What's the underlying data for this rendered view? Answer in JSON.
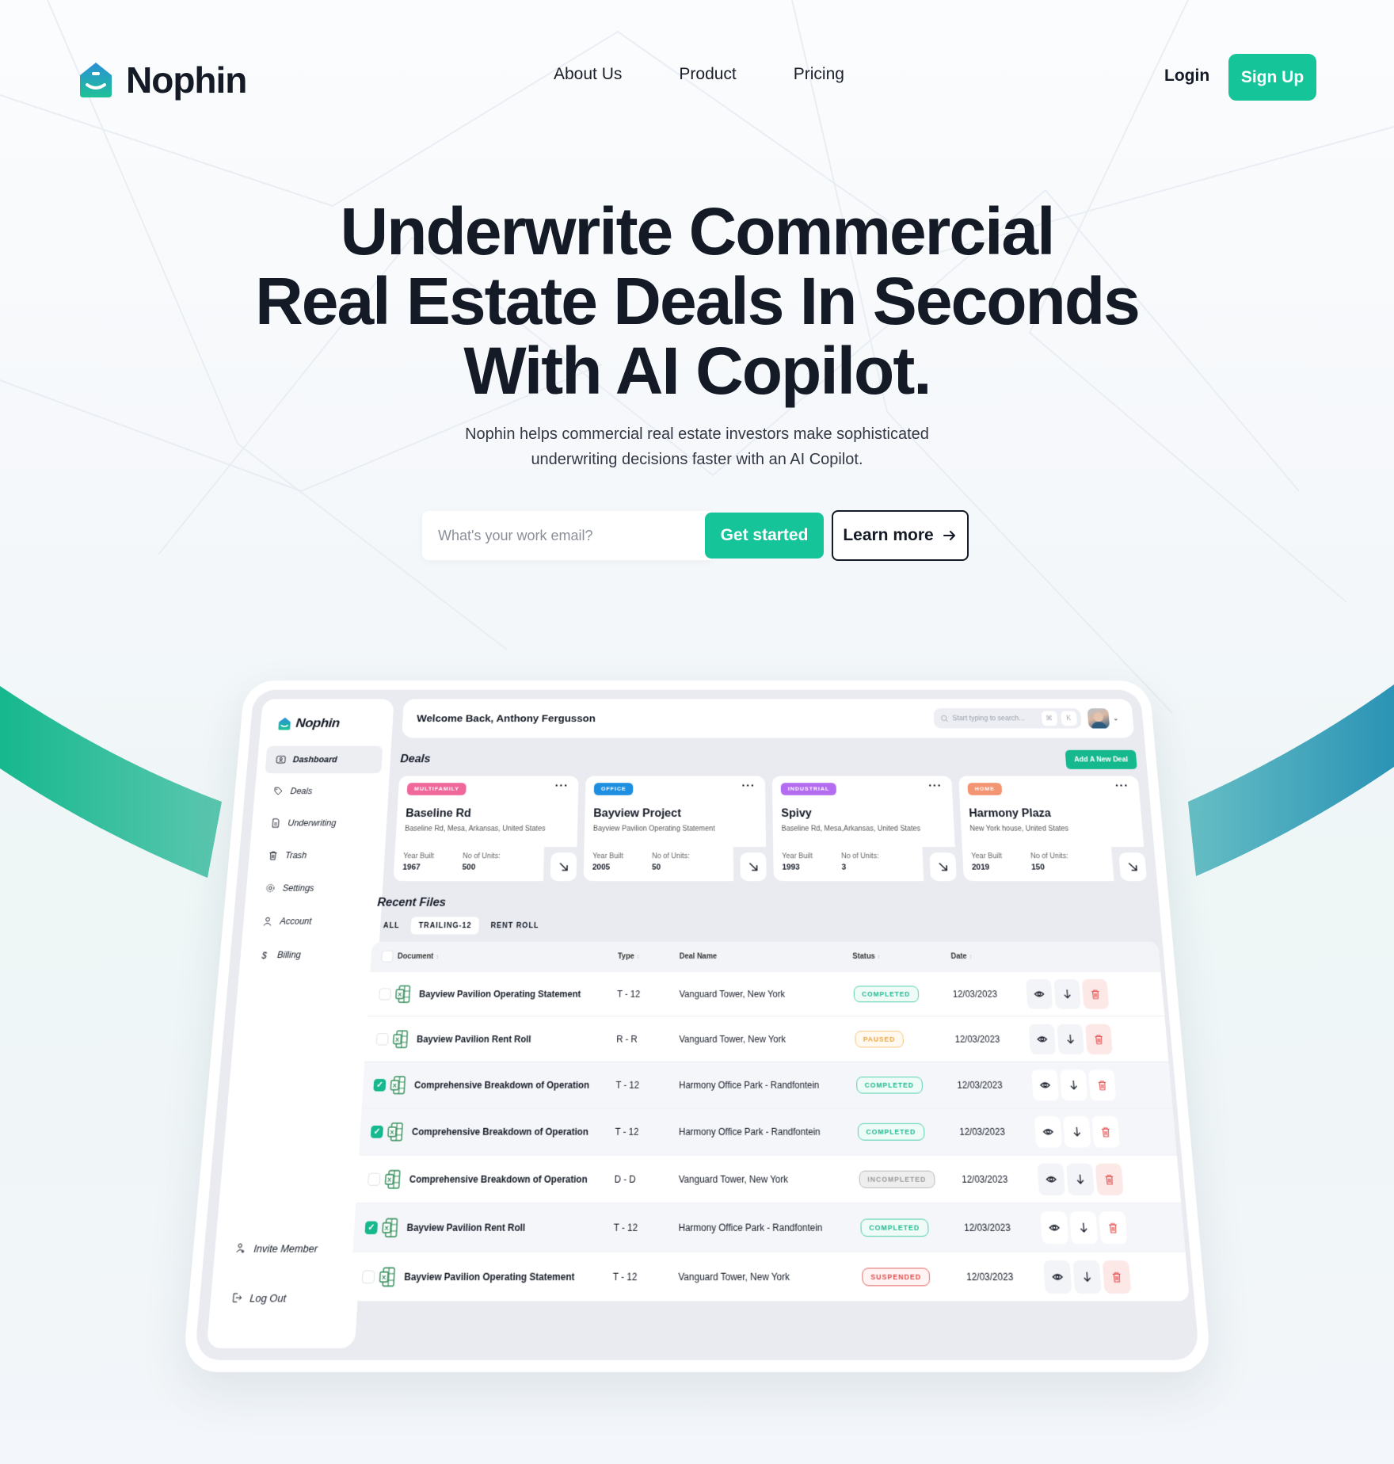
{
  "brand": {
    "name": "Nophin",
    "accent": "#16c49a",
    "accent_dark": "#16b88e",
    "text": "#141a26"
  },
  "nav": {
    "links": [
      "About Us",
      "Product",
      "Pricing"
    ],
    "login": "Login",
    "signup": "Sign Up"
  },
  "hero": {
    "title_lines": [
      "Underwrite Commercial",
      "Real Estate Deals In Seconds",
      "With AI Copilot."
    ],
    "subtitle_lines": [
      "Nophin helps commercial real estate investors make sophisticated",
      "underwriting decisions faster with an AI Copilot."
    ],
    "email_placeholder": "What's your work email?",
    "get_started": "Get started",
    "learn_more": "Learn more"
  },
  "app": {
    "logo": "Nophin",
    "sidebar": {
      "items": [
        {
          "label": "Dashboard",
          "icon": "dashboard-icon",
          "active": true
        },
        {
          "label": "Deals",
          "icon": "tag-icon"
        },
        {
          "label": "Underwriting",
          "icon": "document-icon"
        },
        {
          "label": "Trash",
          "icon": "trash-icon"
        },
        {
          "label": "Settings",
          "icon": "gear-icon"
        },
        {
          "label": "Account",
          "icon": "user-icon"
        },
        {
          "label": "Billing",
          "icon": "dollar-icon"
        }
      ],
      "bottom": [
        {
          "label": "Invite Member",
          "icon": "invite-user-icon"
        },
        {
          "label": "Log Out",
          "icon": "logout-icon"
        }
      ]
    },
    "topbar": {
      "welcome": "Welcome Back, Anthony Fergusson",
      "search_placeholder": "Start typing to search...",
      "kbd_1": "⌘",
      "kbd_2": "K"
    },
    "deals": {
      "title": "Deals",
      "add_button": "Add A New Deal",
      "year_label": "Year Built",
      "units_label": "No of Units:",
      "cards": [
        {
          "tag": "MULTIFAMILY",
          "tag_color": "#f0679a",
          "name": "Baseline Rd",
          "address": "Baseline Rd, Mesa, Arkansas, United States",
          "year": "1967",
          "units": "500"
        },
        {
          "tag": "OFFICE",
          "tag_color": "#1e8fe0",
          "name": "Bayview Project",
          "address": "Bayview Pavilion Operating Statement",
          "year": "2005",
          "units": "50"
        },
        {
          "tag": "INDUSTRIAL",
          "tag_color": "#b36cf0",
          "name": "Spivy",
          "address": "Baseline Rd, Mesa,Arkansas, United States",
          "year": "1993",
          "units": "3"
        },
        {
          "tag": "HOME",
          "tag_color": "#f39472",
          "name": "Harmony Plaza",
          "address": "New York house, United States",
          "year": "2019",
          "units": "150"
        }
      ]
    },
    "files": {
      "title": "Recent Files",
      "tabs": [
        {
          "label": "ALL"
        },
        {
          "label": "TRAILING-12",
          "active": true
        },
        {
          "label": "RENT ROLL"
        }
      ],
      "columns": [
        "Document",
        "Type",
        "Deal Name",
        "Status",
        "Date"
      ],
      "rows": [
        {
          "checked": false,
          "document": "Bayview Pavilion Operating Statement",
          "type": "T - 12",
          "deal": "Vanguard Tower, New York",
          "status": "COMPLETED",
          "status_kind": "completed",
          "date": "12/03/2023"
        },
        {
          "checked": false,
          "document": "Bayview Pavilion Rent Roll",
          "type": "R - R",
          "deal": "Vanguard Tower, New York",
          "status": "PAUSED",
          "status_kind": "paused",
          "date": "12/03/2023"
        },
        {
          "checked": true,
          "document": "Comprehensive Breakdown of Operation",
          "type": "T - 12",
          "deal": "Harmony Office Park - Randfontein",
          "status": "COMPLETED",
          "status_kind": "completed",
          "date": "12/03/2023"
        },
        {
          "checked": true,
          "document": "Comprehensive Breakdown of Operation",
          "type": "T - 12",
          "deal": "Harmony Office Park - Randfontein",
          "status": "COMPLETED",
          "status_kind": "completed",
          "date": "12/03/2023"
        },
        {
          "checked": false,
          "document": "Comprehensive Breakdown of Operation",
          "type": "D - D",
          "deal": "Vanguard Tower, New York",
          "status": "INCOMPLETED",
          "status_kind": "incompleted",
          "date": "12/03/2023"
        },
        {
          "checked": true,
          "document": "Bayview Pavilion Rent Roll",
          "type": "T - 12",
          "deal": "Harmony Office Park - Randfontein",
          "status": "COMPLETED",
          "status_kind": "completed",
          "date": "12/03/2023"
        },
        {
          "checked": false,
          "document": "Bayview Pavilion Operating Statement",
          "type": "T - 12",
          "deal": "Vanguard Tower, New York",
          "status": "SUSPENDED",
          "status_kind": "suspended",
          "date": "12/03/2023"
        }
      ]
    }
  }
}
